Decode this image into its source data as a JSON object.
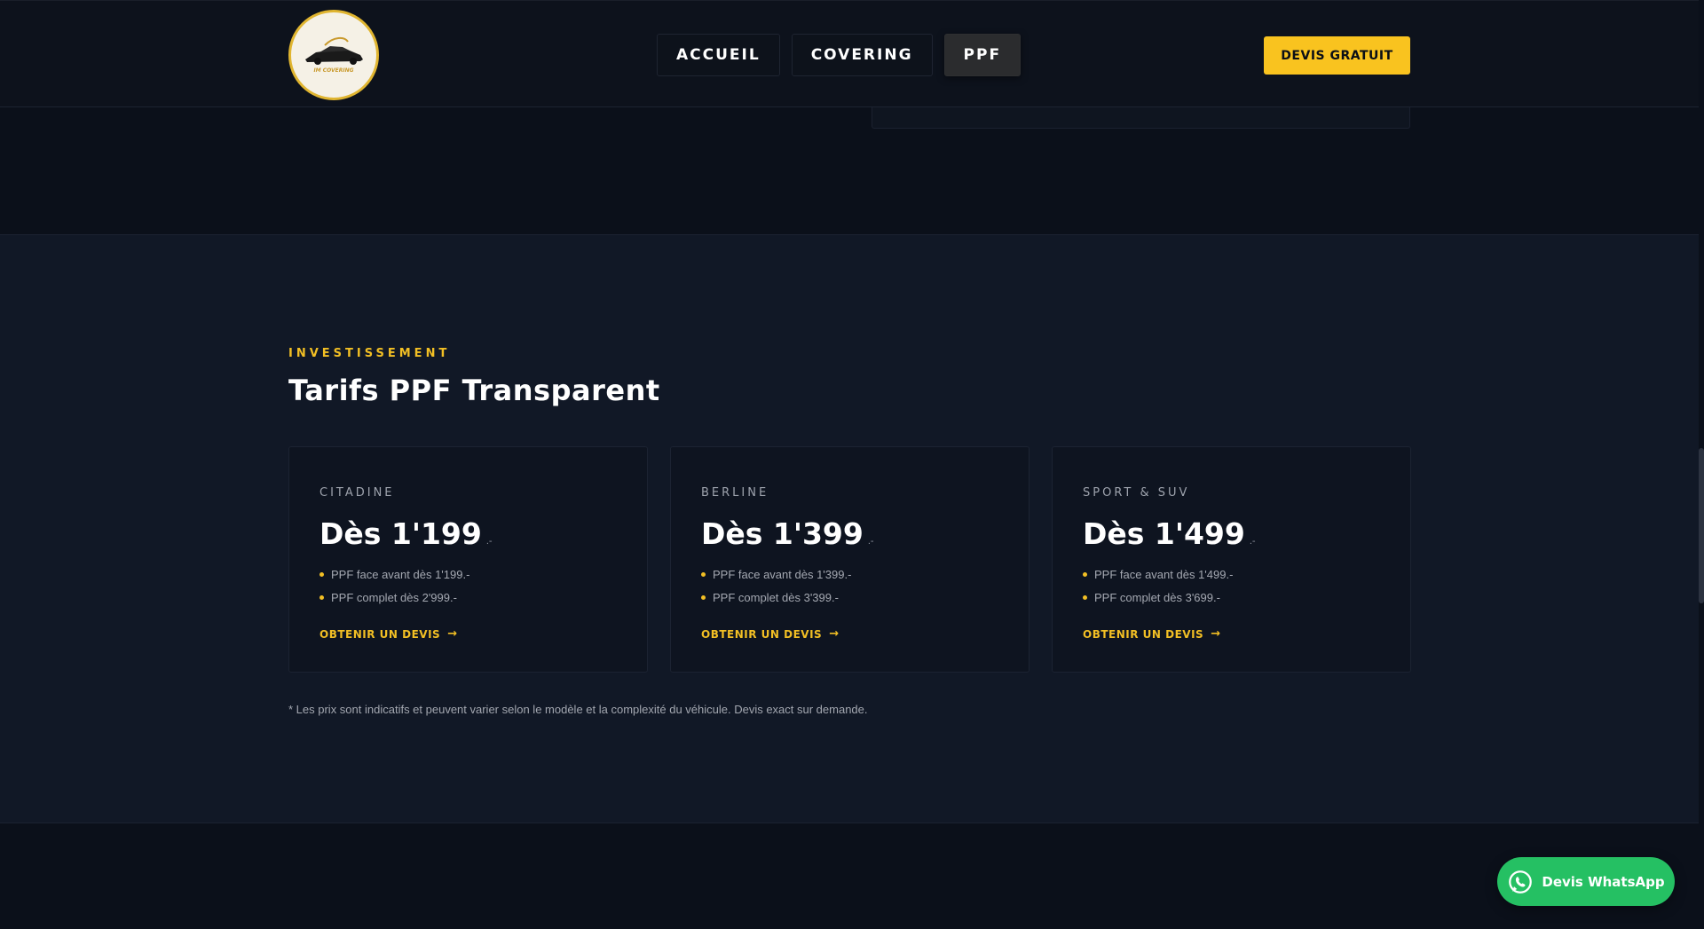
{
  "header": {
    "logo_text": "IM COVERING",
    "nav": [
      {
        "label": "ACCUEIL"
      },
      {
        "label": "COVERING"
      },
      {
        "label": "PPF"
      }
    ],
    "cta_label": "DEVIS GRATUIT"
  },
  "pricing": {
    "eyebrow": "INVESTISSEMENT",
    "title": "Tarifs PPF Transparent",
    "cards": [
      {
        "category": "CITADINE",
        "price": "Dès 1'199",
        "suffix": ".-",
        "features": [
          "PPF face avant dès 1'199.-",
          "PPF complet dès 2'999.-"
        ],
        "link": "OBTENIR UN DEVIS"
      },
      {
        "category": "BERLINE",
        "price": "Dès 1'399",
        "suffix": ".-",
        "features": [
          "PPF face avant dès 1'399.-",
          "PPF complet dès 3'399.-"
        ],
        "link": "OBTENIR UN DEVIS"
      },
      {
        "category": "SPORT & SUV",
        "price": "Dès 1'499",
        "suffix": ".-",
        "features": [
          "PPF face avant dès 1'499.-",
          "PPF complet dès 3'699.-"
        ],
        "link": "OBTENIR UN DEVIS"
      }
    ],
    "disclaimer": "* Les prix sont indicatifs et peuvent varier selon le modèle et la complexité du véhicule. Devis exact sur demande."
  },
  "whatsapp": {
    "label": "Devis WhatsApp",
    "icon": "whatsapp-icon"
  },
  "colors": {
    "accent": "#f9c31f",
    "whatsapp": "#25c063",
    "background": "#0b101a",
    "section": "#111826"
  }
}
